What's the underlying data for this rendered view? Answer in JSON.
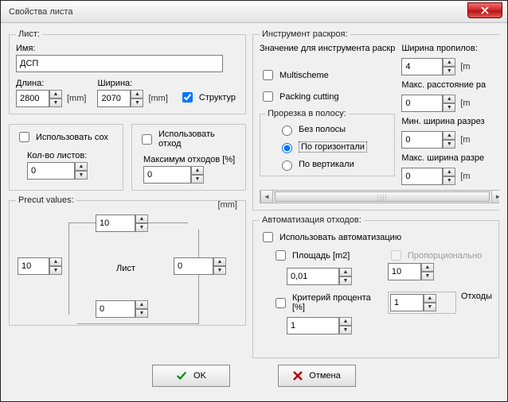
{
  "window": {
    "title": "Свойства листа"
  },
  "sheet": {
    "legend": "Лист:",
    "name_label": "Имя:",
    "name_value": "ДСП",
    "length_label": "Длина:",
    "width_label": "Ширина:",
    "length_value": "2800",
    "width_value": "2070",
    "unit_mm": "[mm]",
    "structure_label": "Структур"
  },
  "use_stock": {
    "label": "Использовать сох",
    "count_label": "Кол-во листов:",
    "count_value": "0"
  },
  "use_waste": {
    "label": "Использовать отход",
    "max_label": "Максимум отходов [%]",
    "max_value": "0"
  },
  "precut": {
    "legend": "Precut values:",
    "top": "10",
    "left": "10",
    "right": "0",
    "bottom": "0",
    "center": "Лист",
    "unit": "[mm]"
  },
  "tool": {
    "legend": "Инструмент раскроя:",
    "value_label": "Значение для инструмента раскр",
    "multischeme": "Multischeme",
    "packing": "Packing cutting",
    "strip_legend": "Прорезка в полосу:",
    "opt_none": "Без полосы",
    "opt_horiz": "По горизонтали",
    "opt_vert": "По вертикали",
    "kerf_label": "Ширина пропилов:",
    "kerf_value": "4",
    "maxdist_label": "Макс. расстояние ра",
    "maxdist_value": "0",
    "mincut_label": "Мин. ширина разрез",
    "mincut_value": "0",
    "maxcut_label": "Макс. ширина разре",
    "maxcut_value": "0",
    "unit_m": "[m"
  },
  "auto": {
    "legend": "Автоматизация отходов:",
    "use_label": "Использовать автоматизацию",
    "area_label": "Площадь [m2]",
    "area_value": "0,01",
    "prop_label": "Пропорционально",
    "waste_label": "Отходы",
    "waste_top": "10",
    "waste_bot": "1",
    "pct_label": "Критерий процента [%]",
    "pct_value": "1"
  },
  "buttons": {
    "ok": "OK",
    "cancel": "Отмена"
  }
}
